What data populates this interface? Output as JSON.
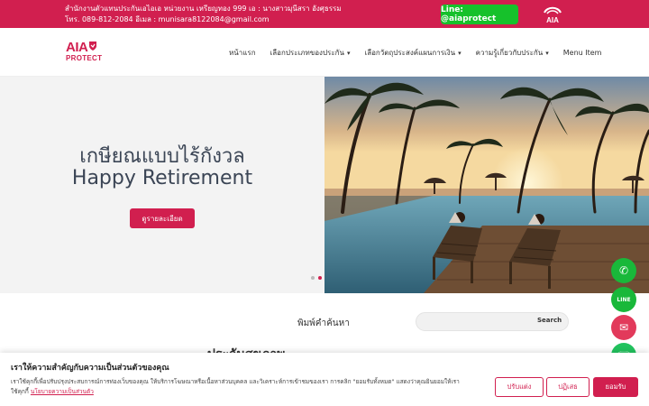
{
  "topbar": {
    "line1": "สำนักงานตัวแทนประกันเอไอเอ หน่วยงาน เหรียญทอง 999 เอ : นางสาวมุนีสรา อังศุธรรม",
    "line2": "โทร. 089-812-2084 อีเมล : munisara8122084@gmail.com",
    "line_button": "Line: @aiaprotect",
    "badge_text": "AIA"
  },
  "logo": {
    "line1": "AIA",
    "line2": "PROTECT"
  },
  "nav": {
    "items": [
      {
        "label": "หน้าแรก",
        "dropdown": false
      },
      {
        "label": "เลือกประเภทของประกัน",
        "dropdown": true
      },
      {
        "label": "เลือกวัตถุประสงค์แผนการเงิน",
        "dropdown": true
      },
      {
        "label": "ความรู้เกี่ยวกับประกัน",
        "dropdown": true
      },
      {
        "label": "Menu Item",
        "dropdown": false
      }
    ]
  },
  "hero": {
    "title_th": "เกษียณแบบไร้กังวล",
    "title_en": "Happy Retirement",
    "button": "ดูรายละเอียด",
    "slides": 2,
    "active_slide": 2
  },
  "search": {
    "label": "พิมพ์คำค้นหา",
    "placeholder": "",
    "button": "Search"
  },
  "section": {
    "heading": "ประกันสุขภาพ"
  },
  "cookie": {
    "title": "เราให้ความสำคัญกับความเป็นส่วนตัวของคุณ",
    "body": "เราใช้คุกกี้เพื่อปรับปรุงประสบการณ์การท่องเว็บของคุณ ให้บริการโฆษณาหรือเนื้อหาส่วนบุคคล และวิเคราะห์การเข้าชมของเรา การคลิก \"ยอมรับทั้งหมด\" แสดงว่าคุณยินยอมให้เราใช้คุกกี้",
    "policy_link": "นโยบายความเป็นส่วนตัว",
    "customize": "ปรับแต่ง",
    "reject": "ปฏิเสธ",
    "accept": "ยอมรับ"
  },
  "colors": {
    "brand": "#d11f4f",
    "line_green": "#16c12b",
    "hero_text": "#3b4555"
  },
  "fabs": [
    {
      "name": "phone",
      "color": "#19b83a",
      "glyph": "✆"
    },
    {
      "name": "line",
      "color": "#19b83a",
      "glyph": "LINE"
    },
    {
      "name": "email",
      "color": "#e23a5b",
      "glyph": "✉"
    },
    {
      "name": "whatsapp",
      "color": "#22c35e",
      "glyph": "☏"
    }
  ]
}
